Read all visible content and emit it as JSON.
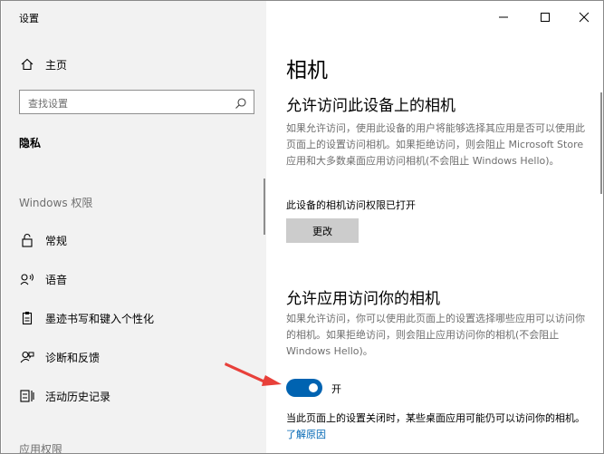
{
  "window": {
    "title": "设置"
  },
  "sidebar": {
    "home_label": "主页",
    "search_placeholder": "查找设置",
    "section_title": "隐私",
    "group_label": "Windows 权限",
    "group_label_2": "应用权限",
    "items": [
      {
        "label": "常规",
        "icon": "lock-icon"
      },
      {
        "label": "语音",
        "icon": "speech-icon"
      },
      {
        "label": "墨迹书写和键入个性化",
        "icon": "clipboard-icon"
      },
      {
        "label": "诊断和反馈",
        "icon": "feedback-icon"
      },
      {
        "label": "活动历史记录",
        "icon": "timeline-icon"
      }
    ]
  },
  "content": {
    "title": "相机",
    "section1_title": "允许访问此设备上的相机",
    "section1_desc": "如果允许访问，使用此设备的用户将能够选择其应用是否可以使用此页面上的设置访问相机。如果拒绝访问，则会阻止 Microsoft Store 应用和大多数桌面应用访问相机(不会阻止 Windows Hello)。",
    "device_status": "此设备的相机访问权限已打开",
    "change_button": "更改",
    "section2_title": "允许应用访问你的相机",
    "section2_desc": "如果允许访问，你可以使用此页面上的设置选择哪些应用可以访问你的相机。如果拒绝访问，则会阻止应用访问你的相机(不会阻止 Windows Hello)。",
    "toggle_label": "开",
    "toggle_on": true,
    "note_text": "当此页面上的设置关闭时，某些桌面应用可能仍可以访问你的相机。",
    "note_link": "了解原因"
  },
  "colors": {
    "accent": "#0063b1",
    "link": "#0066b4",
    "arrow": "#e8403a",
    "sidebar_bg": "#f2f2f2"
  }
}
